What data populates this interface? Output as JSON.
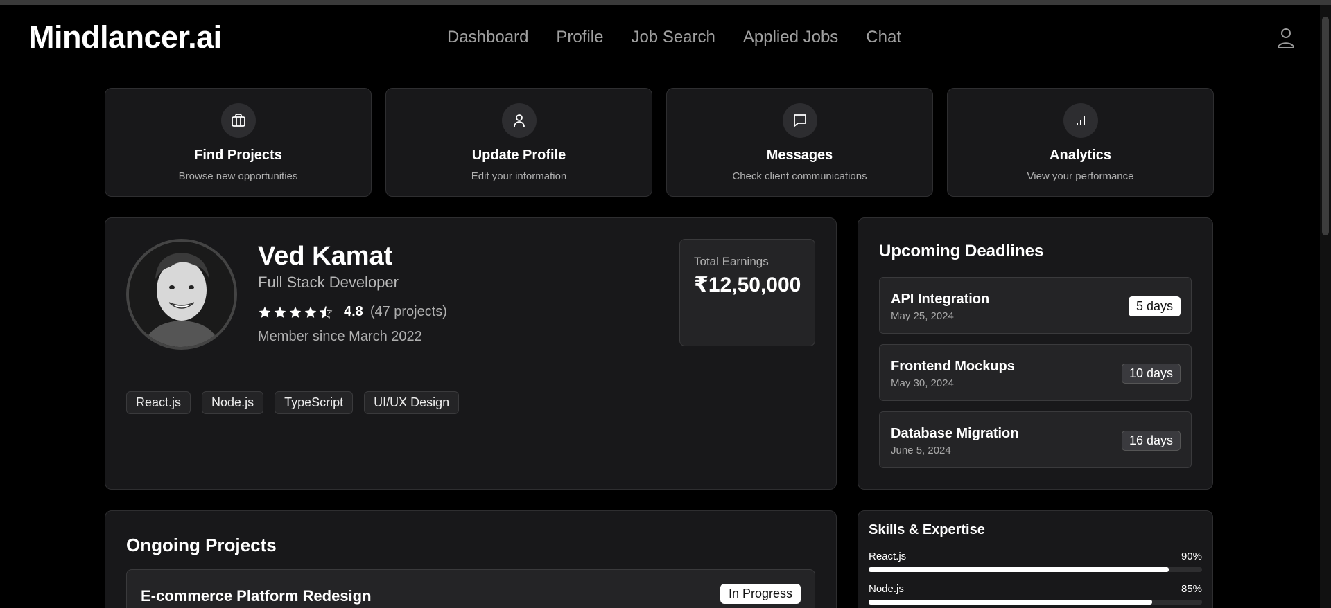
{
  "header": {
    "logo": "Mindlancer.ai",
    "nav": [
      "Dashboard",
      "Profile",
      "Job Search",
      "Applied Jobs",
      "Chat"
    ]
  },
  "quick_actions": [
    {
      "icon": "briefcase-icon",
      "title": "Find Projects",
      "subtitle": "Browse new opportunities"
    },
    {
      "icon": "user-icon",
      "title": "Update Profile",
      "subtitle": "Edit your information"
    },
    {
      "icon": "message-icon",
      "title": "Messages",
      "subtitle": "Check client communications"
    },
    {
      "icon": "bar-chart-icon",
      "title": "Analytics",
      "subtitle": "View your performance"
    }
  ],
  "profile": {
    "name": "Ved Kamat",
    "role": "Full Stack Developer",
    "rating": "4.8",
    "rating_stars": 4.5,
    "projects": "(47 projects)",
    "member_since": "Member since March 2022",
    "earnings_label": "Total Earnings",
    "earnings_value": "₹12,50,000",
    "tags": [
      "React.js",
      "Node.js",
      "TypeScript",
      "UI/UX Design"
    ]
  },
  "deadlines": {
    "title": "Upcoming Deadlines",
    "items": [
      {
        "name": "API Integration",
        "date": "May 25, 2024",
        "badge": "5 days"
      },
      {
        "name": "Frontend Mockups",
        "date": "May 30, 2024",
        "badge": "10 days"
      },
      {
        "name": "Database Migration",
        "date": "June 5, 2024",
        "badge": "16 days"
      }
    ]
  },
  "ongoing": {
    "title": "Ongoing Projects",
    "items": [
      {
        "name": "E-commerce Platform Redesign",
        "status": "In Progress"
      }
    ]
  },
  "skills": {
    "title": "Skills & Expertise",
    "items": [
      {
        "name": "React.js",
        "pct": "90%",
        "value": 90
      },
      {
        "name": "Node.js",
        "pct": "85%",
        "value": 85
      }
    ]
  },
  "colors": {
    "background": "#000000",
    "card": "#18181a",
    "accent": "#ffffff"
  }
}
